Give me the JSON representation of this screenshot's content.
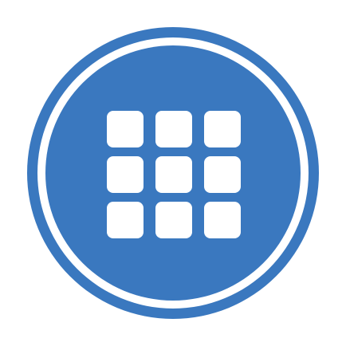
{
  "icon": {
    "semantic": "app-grid-icon",
    "colors": {
      "brand_blue": "#3a78bf",
      "ring_gap": "#ffffff",
      "tile": "#ffffff",
      "background": "#ffffff"
    },
    "grid": {
      "rows": 3,
      "columns": 3
    }
  }
}
